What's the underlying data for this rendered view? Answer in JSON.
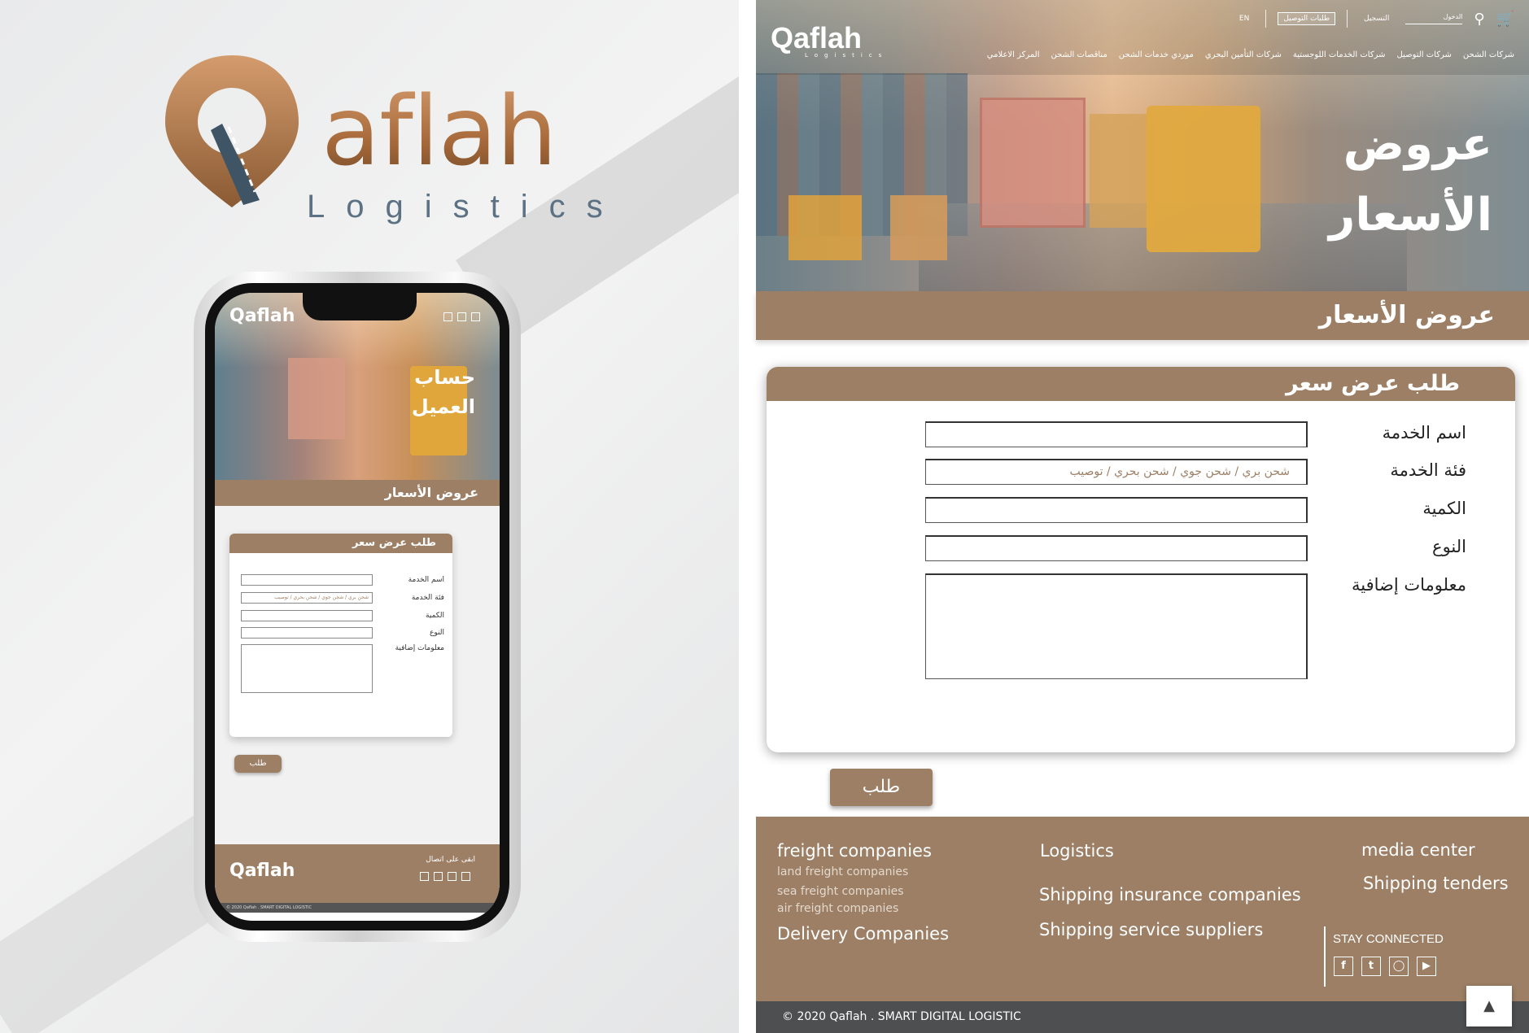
{
  "brand": {
    "logo_word": "aflah",
    "logo_letter": "Q",
    "logo_sub": "Logistics"
  },
  "phone": {
    "logo": "Qaflah",
    "hero_title_1": "حساب",
    "hero_title_2": "العميل",
    "band": "عروض الأسعار",
    "card_title": "طلب عرض سعر",
    "fields": [
      {
        "label": "اسم الخدمة",
        "placeholder": ""
      },
      {
        "label": "فئة الخدمة",
        "placeholder": "شحن بري / شحن جوي / شحن بحري / توصيب"
      },
      {
        "label": "الكمية",
        "placeholder": ""
      },
      {
        "label": "النوع",
        "placeholder": ""
      },
      {
        "label": "معلومات إضافية",
        "placeholder": ""
      }
    ],
    "submit": "طلب",
    "footer_logo": "Qaflah",
    "stay": "ابقى على اتصال",
    "copyright": "© 2020 Qaflah . SMART DIGITAL LOGISTIC"
  },
  "desktop": {
    "logo": "Qaflah",
    "logo_sub": "Logistics",
    "util": {
      "lang": "EN",
      "orders": "طلبات التوصيل",
      "register": "التسجيل",
      "login": "الدخول"
    },
    "nav": [
      "شركات الشحن",
      "شركات التوصيل",
      "شركات الخدمات اللوجستية",
      "شركات التأمين البحري",
      "موردي خدمات الشحن",
      "مناقصات الشحن",
      "المركز الاعلامي"
    ],
    "hero_title_1": "عروض",
    "hero_title_2": "الأسعار",
    "band": "عروض الأسعار",
    "card_title": "طلب عرض سعر",
    "fields": [
      {
        "label": "اسم الخدمة",
        "placeholder": ""
      },
      {
        "label": "فئة الخدمة",
        "placeholder": "شحن بري / شحن جوي / شحن بحري / توصيب"
      },
      {
        "label": "الكمية",
        "placeholder": ""
      },
      {
        "label": "النوع",
        "placeholder": ""
      },
      {
        "label": "معلومات إضافية",
        "placeholder": ""
      }
    ],
    "submit": "طلب",
    "footer": {
      "freight": "freight companies",
      "freight_sub": [
        "land freight companies",
        "sea freight companies",
        "air freight companies"
      ],
      "delivery": "Delivery Companies",
      "logistics": "Logistics",
      "insurance": "Shipping insurance companies",
      "suppliers": "Shipping service suppliers",
      "media": "media center",
      "tenders": "Shipping tenders",
      "stay": "STAY CONNECTED"
    },
    "copyright": "© 2020 Qaflah  . SMART DIGITAL LOGISTIC"
  },
  "colors": {
    "brand_brown": "#9c7f65",
    "dark_bar": "#4e4f50",
    "logo_copper": "#b77a4a",
    "logo_slate": "#5c7284"
  }
}
